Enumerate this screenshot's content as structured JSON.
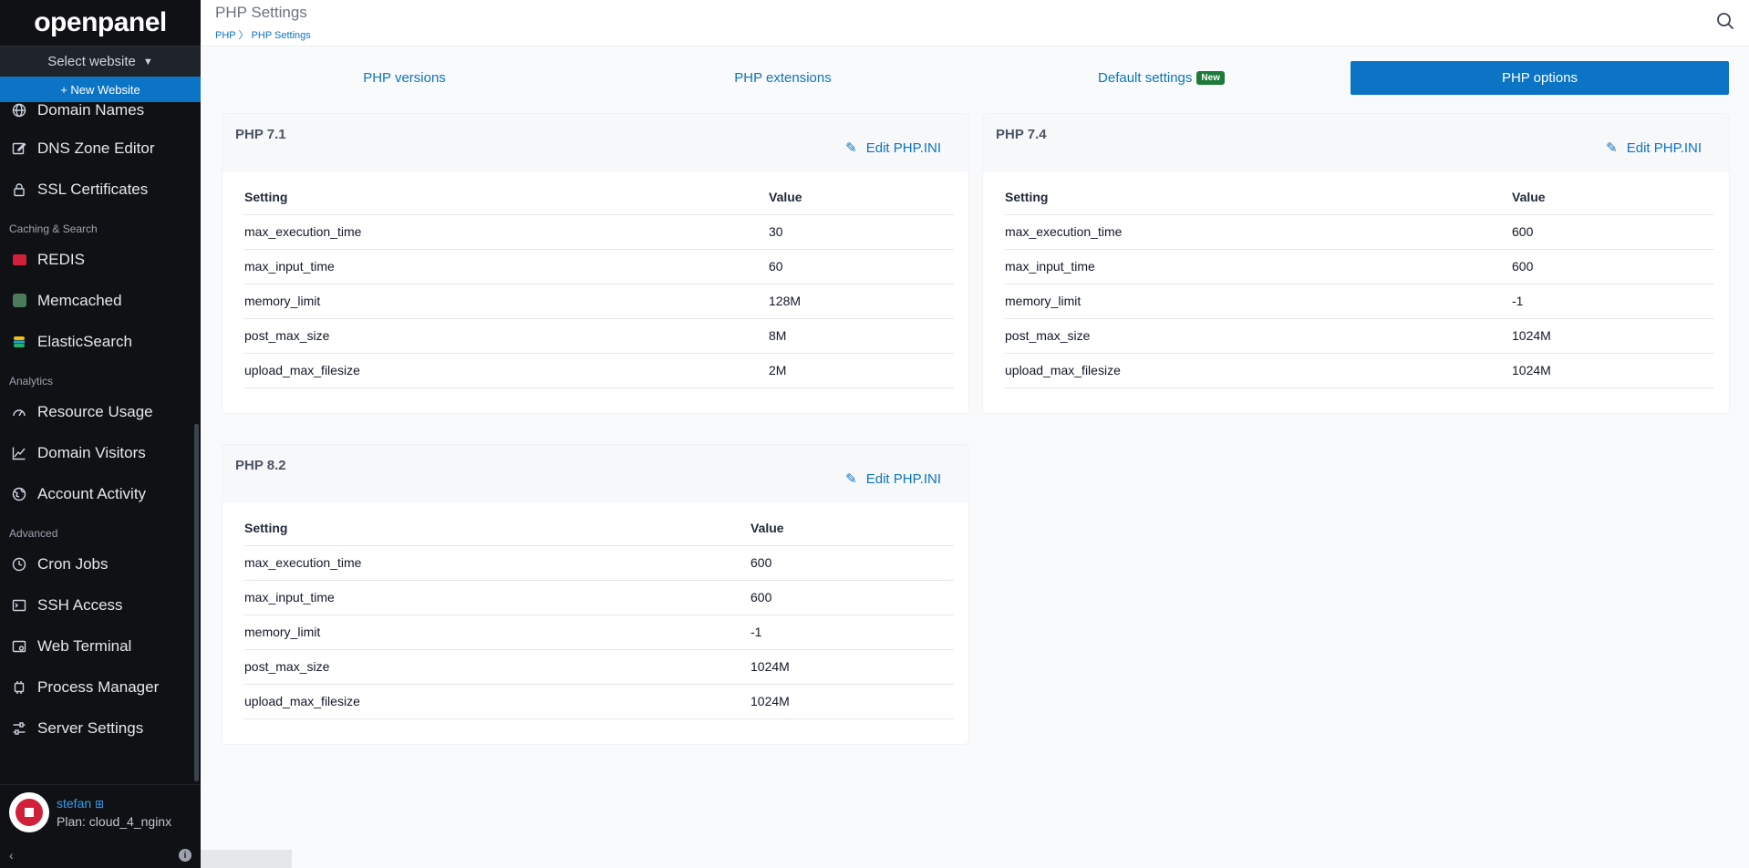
{
  "sidebar": {
    "logo": "openpanel",
    "select_website": "Select website",
    "new_website": "+ New Website",
    "items": [
      {
        "label": "Domain Names",
        "icon": "globe-icon"
      },
      {
        "label": "DNS Zone Editor",
        "icon": "edit-icon"
      },
      {
        "label": "SSL Certificates",
        "icon": "lock-icon"
      }
    ],
    "sections": [
      {
        "title": "Caching & Search",
        "items": [
          {
            "label": "REDIS",
            "icon": "redis-icon"
          },
          {
            "label": "Memcached",
            "icon": "memcached-icon"
          },
          {
            "label": "ElasticSearch",
            "icon": "elasticsearch-icon"
          }
        ]
      },
      {
        "title": "Analytics",
        "items": [
          {
            "label": "Resource Usage",
            "icon": "gauge-icon"
          },
          {
            "label": "Domain Visitors",
            "icon": "chart-icon"
          },
          {
            "label": "Account Activity",
            "icon": "globe-icon"
          }
        ]
      },
      {
        "title": "Advanced",
        "items": [
          {
            "label": "Cron Jobs",
            "icon": "clock-icon"
          },
          {
            "label": "SSH Access",
            "icon": "terminal-icon"
          },
          {
            "label": "Web Terminal",
            "icon": "web-terminal-icon"
          },
          {
            "label": "Process Manager",
            "icon": "cpu-icon"
          },
          {
            "label": "Server Settings",
            "icon": "sliders-icon"
          }
        ]
      }
    ],
    "user": {
      "name": "stefan",
      "plan": "Plan: cloud_4_nginx"
    }
  },
  "header": {
    "title": "PHP Settings",
    "breadcrumb": [
      "PHP",
      "PHP Settings"
    ]
  },
  "tabs": [
    {
      "label": "PHP versions",
      "active": false
    },
    {
      "label": "PHP extensions",
      "active": false
    },
    {
      "label": "Default settings",
      "badge": "New",
      "active": false
    },
    {
      "label": "PHP options",
      "active": true
    }
  ],
  "cards": [
    {
      "title": "PHP 7.1",
      "edit_label": "Edit PHP.INI",
      "col_setting": "Setting",
      "col_value": "Value",
      "rows": [
        {
          "setting": "max_execution_time",
          "value": "30"
        },
        {
          "setting": "max_input_time",
          "value": "60"
        },
        {
          "setting": "memory_limit",
          "value": "128M"
        },
        {
          "setting": "post_max_size",
          "value": "8M"
        },
        {
          "setting": "upload_max_filesize",
          "value": "2M"
        }
      ]
    },
    {
      "title": "PHP 7.4",
      "edit_label": "Edit PHP.INI",
      "col_setting": "Setting",
      "col_value": "Value",
      "rows": [
        {
          "setting": "max_execution_time",
          "value": "600"
        },
        {
          "setting": "max_input_time",
          "value": "600"
        },
        {
          "setting": "memory_limit",
          "value": "-1"
        },
        {
          "setting": "post_max_size",
          "value": "1024M"
        },
        {
          "setting": "upload_max_filesize",
          "value": "1024M"
        }
      ]
    },
    {
      "title": "PHP 8.2",
      "edit_label": "Edit PHP.INI",
      "col_setting": "Setting",
      "col_value": "Value",
      "rows": [
        {
          "setting": "max_execution_time",
          "value": "600"
        },
        {
          "setting": "max_input_time",
          "value": "600"
        },
        {
          "setting": "memory_limit",
          "value": "-1"
        },
        {
          "setting": "post_max_size",
          "value": "1024M"
        },
        {
          "setting": "upload_max_filesize",
          "value": "1024M"
        }
      ]
    }
  ],
  "colors": {
    "accent": "#0b74c4",
    "sidebar_bg": "#0f1115",
    "badge_green": "#1d7a3a"
  }
}
